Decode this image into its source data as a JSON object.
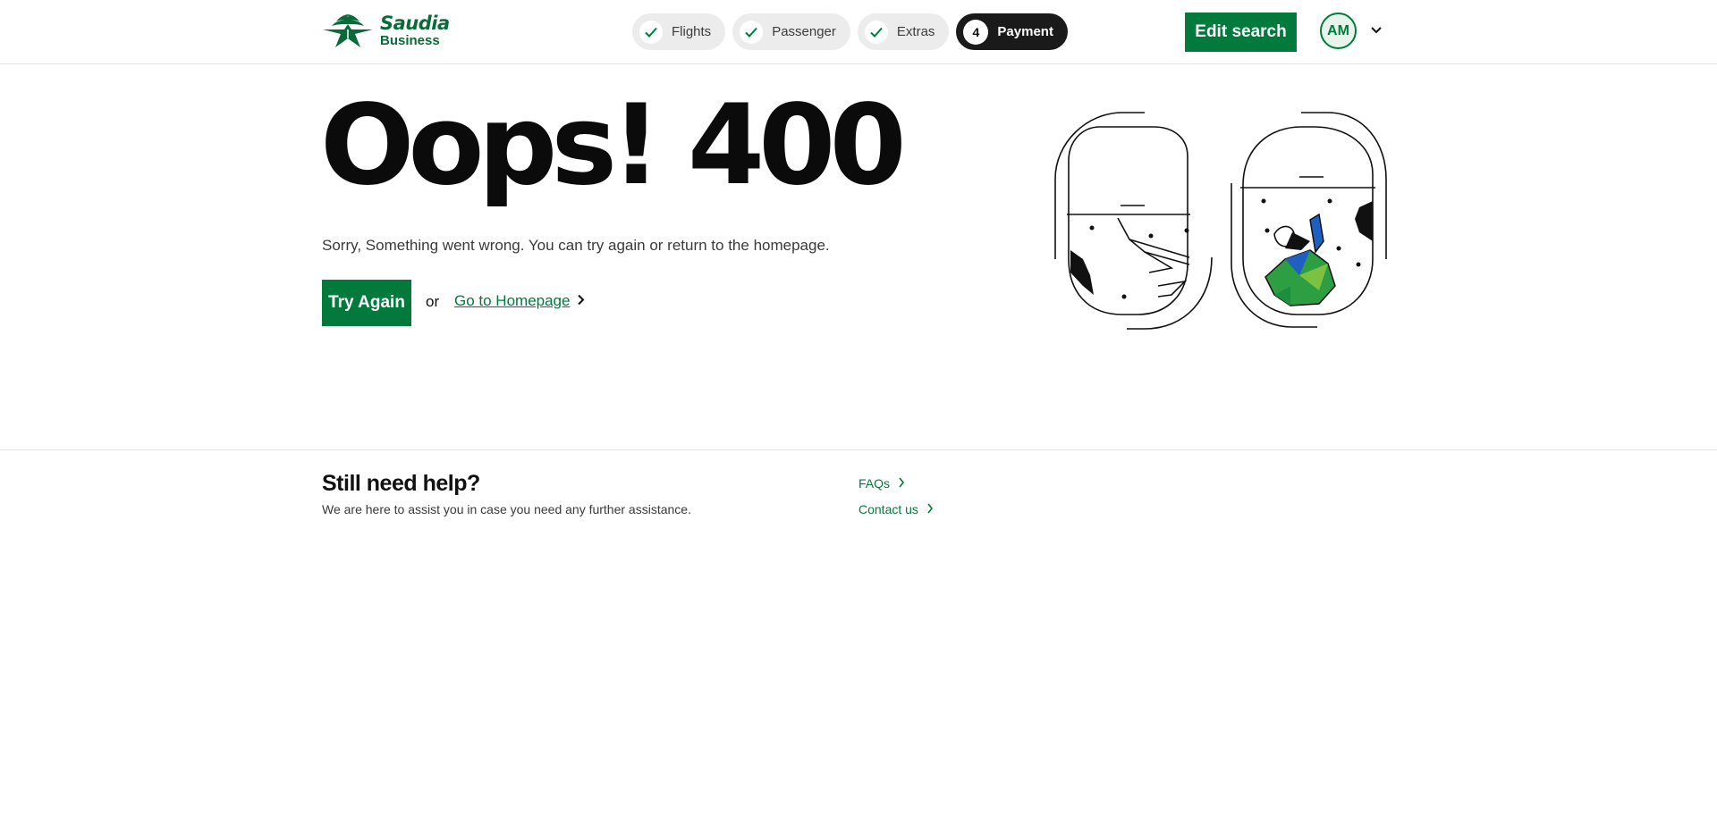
{
  "header": {
    "logo_brand": "Saudia",
    "logo_sub": "Business",
    "steps": [
      {
        "label": "Flights",
        "state": "done"
      },
      {
        "label": "Passenger",
        "state": "done"
      },
      {
        "label": "Extras",
        "state": "done"
      },
      {
        "label": "Payment",
        "state": "active",
        "number": "4"
      }
    ],
    "edit_search_label": "Edit search",
    "avatar_initials": "AM"
  },
  "main": {
    "title": "Oops! 400",
    "description": "Sorry, Something went wrong. You can try again or return to the homepage.",
    "try_again_label": "Try Again",
    "or_text": "or",
    "homepage_link": "Go to Homepage"
  },
  "help": {
    "title": "Still need help?",
    "subtitle": "We are here to assist you in case you need any further assistance.",
    "links": [
      "FAQs",
      "Contact us"
    ]
  },
  "colors": {
    "brand_green": "#017a3c",
    "dark": "#1a1a1a",
    "step_bg": "#ececec"
  },
  "icons": [
    "saudia-palm-logo-icon",
    "check-icon",
    "chevron-down-icon",
    "chevron-right-icon"
  ]
}
